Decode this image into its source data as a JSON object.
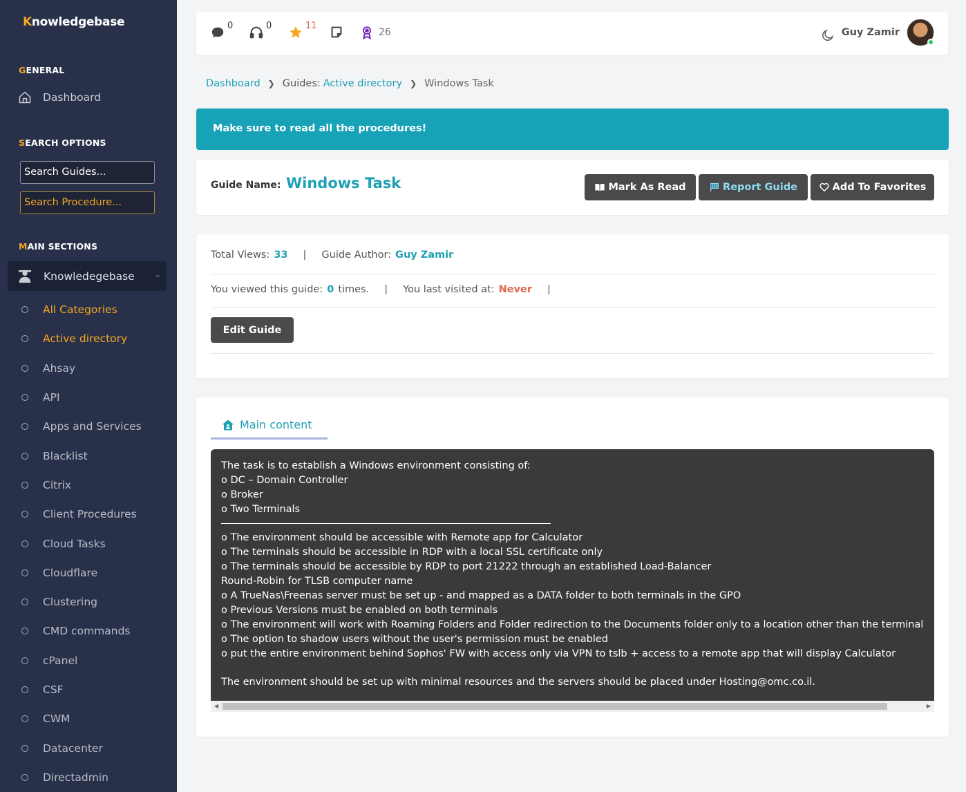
{
  "app": {
    "logo": "Knowledgebase",
    "logo_first": "K",
    "logo_rest": "nowledgebase"
  },
  "sidebar": {
    "general": {
      "first": "G",
      "rest": "ENERAL"
    },
    "dashboard": "Dashboard",
    "search_options": {
      "first": "S",
      "rest": "EARCH OPTIONS"
    },
    "search_guides": "Search Guides...",
    "search_procedure": "Search Procedure...",
    "main_sections": {
      "first": "M",
      "rest": "AIN SECTIONS"
    },
    "kb_item": "Knowledegebase",
    "categories": [
      "All Categories",
      "Active directory",
      "Ahsay",
      "API",
      "Apps and Services",
      "Blacklist",
      "Citrix",
      "Client Procedures",
      "Cloud Tasks",
      "Cloudflare",
      "Clustering",
      "CMD commands",
      "cPanel",
      "CSF",
      "CWM",
      "Datacenter",
      "Directadmin"
    ]
  },
  "topbar": {
    "messages": "0",
    "support": "0",
    "favorites": "11",
    "badges": "26",
    "user": "Guy Zamir"
  },
  "breadcrumb": {
    "dashboard": "Dashboard",
    "guides_prefix": "Guides:",
    "guides_link": "Active directory",
    "current": "Windows Task"
  },
  "alert": "Make sure to read all the procedures!",
  "guide": {
    "label": "Guide Name:",
    "name": "Windows Task",
    "mark_read": "Mark As Read",
    "report": "Report Guide",
    "favorite": "Add To Favorites"
  },
  "stats": {
    "total_views_label": "Total Views:",
    "total_views": "33",
    "author_label": "Guide Author:",
    "author": "Guy Zamir",
    "viewed_label": "You viewed this guide:",
    "viewed_count": "0",
    "viewed_suffix": "times.",
    "last_visited_label": "You last visited at:",
    "last_visited": "Never",
    "edit": "Edit Guide"
  },
  "content": {
    "tab": "Main content",
    "lines_a": [
      "The task is to establish a Windows environment consisting of:",
      "o DC – Domain Controller",
      "o Broker",
      "o Two Terminals"
    ],
    "lines_b": [
      "o The environment should be accessible with Remote app for Calculator",
      "o The terminals should be accessible in RDP with a local SSL certificate only",
      "o The terminals should be accessible by RDP to port 21222 through an established Load-Balancer",
      "Round-Robin for TLSB computer name",
      "o A TrueNas\\Freenas server must be set up - and mapped as a DATA folder to both terminals in the GPO",
      "o Previous Versions must be enabled on both terminals",
      "o The environment will work with Roaming Folders and Folder redirection to the Documents folder only to a location other than the terminal",
      "o The option to shadow users without the user's permission must be enabled",
      "o put the entire environment behind Sophos' FW with access only via VPN to tslb + access to a remote app that will display Calculator"
    ],
    "line_c": "The environment should be set up with minimal resources and the servers should be placed under Hosting@omc.co.il."
  },
  "colors": {
    "sidebar": "#283149",
    "accent": "#f5a623",
    "teal": "#17a2b8",
    "link": "#1fa0b4",
    "danger": "#e0674f"
  }
}
